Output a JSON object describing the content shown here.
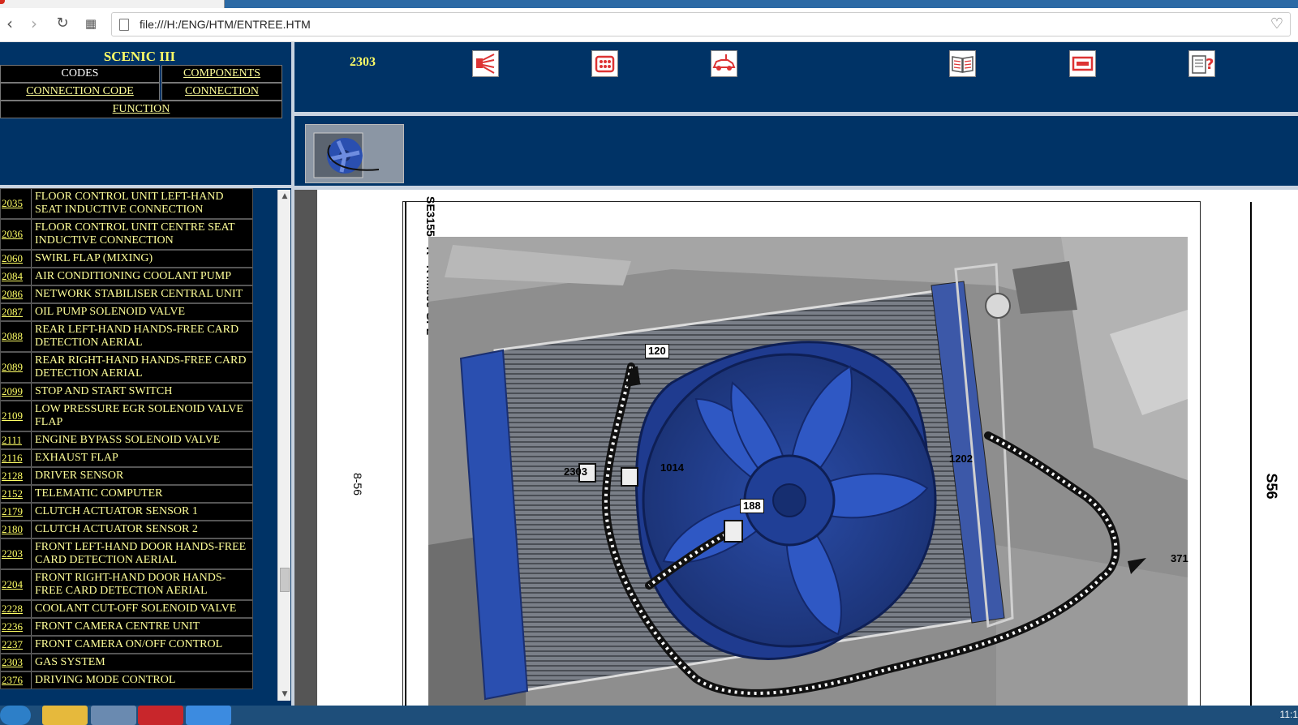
{
  "browser": {
    "url": "file:///H:/ENG/HTM/ENTREE.HTM",
    "back_icon": "back-arrow-icon",
    "forward_icon": "forward-arrow-icon",
    "reload_icon": "reload-icon",
    "apps_icon": "grid-icon",
    "bookmark_icon": "heart-icon"
  },
  "left_header": {
    "model": "SCENIC III",
    "nav": {
      "codes": "CODES",
      "components": "COMPONENTS",
      "connection_code": "CONNECTION CODE",
      "connection": "CONNECTION",
      "function": "FUNCTION"
    }
  },
  "component_list": [
    {
      "code": "2035",
      "desc": "FLOOR CONTROL UNIT LEFT-HAND SEAT INDUCTIVE CONNECTION"
    },
    {
      "code": "2036",
      "desc": "FLOOR CONTROL UNIT CENTRE SEAT INDUCTIVE CONNECTION"
    },
    {
      "code": "2060",
      "desc": "SWIRL FLAP (MIXING)"
    },
    {
      "code": "2084",
      "desc": "AIR CONDITIONING COOLANT PUMP"
    },
    {
      "code": "2086",
      "desc": "NETWORK STABILISER CENTRAL UNIT"
    },
    {
      "code": "2087",
      "desc": "OIL PUMP SOLENOID VALVE"
    },
    {
      "code": "2088",
      "desc": "REAR LEFT-HAND HANDS-FREE CARD DETECTION AERIAL"
    },
    {
      "code": "2089",
      "desc": "REAR RIGHT-HAND HANDS-FREE CARD DETECTION AERIAL"
    },
    {
      "code": "2099",
      "desc": "STOP AND START SWITCH"
    },
    {
      "code": "2109",
      "desc": "LOW PRESSURE EGR SOLENOID VALVE FLAP"
    },
    {
      "code": "2111",
      "desc": "ENGINE BYPASS SOLENOID VALVE"
    },
    {
      "code": "2116",
      "desc": "EXHAUST FLAP"
    },
    {
      "code": "2128",
      "desc": "DRIVER SENSOR"
    },
    {
      "code": "2152",
      "desc": "TELEMATIC COMPUTER"
    },
    {
      "code": "2179",
      "desc": "CLUTCH ACTUATOR SENSOR 1"
    },
    {
      "code": "2180",
      "desc": "CLUTCH ACTUATOR SENSOR 2"
    },
    {
      "code": "2203",
      "desc": "FRONT LEFT-HAND DOOR HANDS-FREE CARD DETECTION AERIAL"
    },
    {
      "code": "2204",
      "desc": "FRONT RIGHT-HAND DOOR HANDS-FREE CARD DETECTION AERIAL"
    },
    {
      "code": "2228",
      "desc": "COOLANT CUT-OFF SOLENOID VALVE"
    },
    {
      "code": "2236",
      "desc": "FRONT CAMERA CENTRE UNIT"
    },
    {
      "code": "2237",
      "desc": "FRONT CAMERA ON/OFF CONTROL"
    },
    {
      "code": "2303",
      "desc": "GAS SYSTEM"
    },
    {
      "code": "2376",
      "desc": "DRIVING MODE CONTROL"
    }
  ],
  "right_header": {
    "current_code": "2303",
    "tools": [
      "wiring-icon",
      "connector-icon",
      "vehicle-location-icon",
      "book-icon",
      "fuse-box-icon",
      "help-icon"
    ]
  },
  "diagram": {
    "figure_id": "SE3155 - R - K4M866-GPL",
    "page_number": "8-56",
    "section": "S56",
    "callouts": [
      "120",
      "2303",
      "1014",
      "188",
      "1202",
      "371"
    ]
  },
  "taskbar": {
    "clock": "11:1"
  },
  "colors": {
    "panel_blue": "#003366",
    "link_yellow": "#ffff66",
    "fan_blue": "#2a4fb0"
  }
}
